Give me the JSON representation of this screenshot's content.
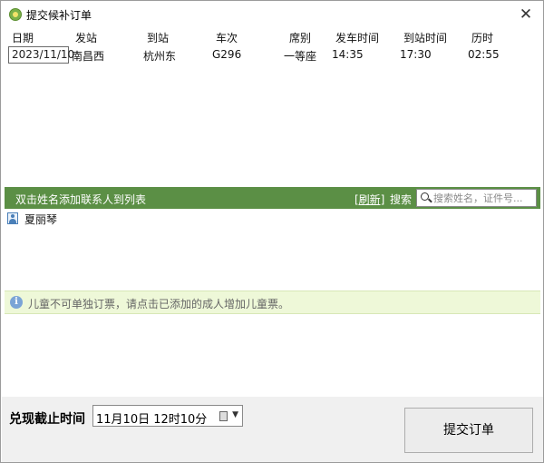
{
  "window": {
    "title": "提交候补订单",
    "close_glyph": "✕"
  },
  "grid": {
    "columns": [
      "日期",
      "发站",
      "到站",
      "车次",
      "席别",
      "发车时间",
      "到站时间",
      "历时"
    ],
    "rows": [
      {
        "date": "2023/11/10",
        "from": "南昌西",
        "to": "杭州东",
        "train": "G296",
        "seat": "一等座",
        "depart": "14:35",
        "arrive": "17:30",
        "duration": "02:55"
      }
    ]
  },
  "contacts_bar": {
    "hint": "双击姓名添加联系人到列表",
    "refresh": "[刷新]",
    "search_label": "搜索",
    "search_placeholder": "搜索姓名，证件号..."
  },
  "contacts": [
    {
      "name": "夏丽琴",
      "icon": "person-icon"
    }
  ],
  "info": {
    "icon": "info-icon",
    "message": "儿童不可单独订票，请点击已添加的成人增加儿童票。"
  },
  "footer": {
    "deadline_label": "兑现截止时间",
    "deadline_value": "11月10日  12时10分",
    "submit_label": "提交订单"
  },
  "colors": {
    "accent_green": "#5b8f45",
    "info_bg": "#eef8d8"
  }
}
